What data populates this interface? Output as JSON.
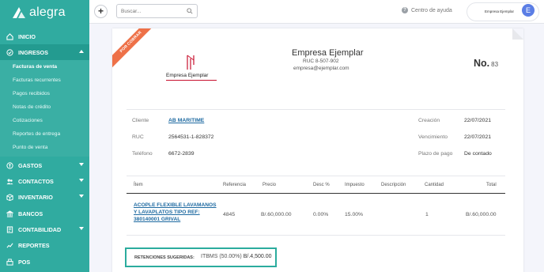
{
  "app": {
    "logo_text": "alegra"
  },
  "topbar": {
    "search_placeholder": "Buscar...",
    "help_label": "Centro de ayuda",
    "company_logo_text": "Empresa Ejemplar",
    "avatar_initial": "E"
  },
  "sidebar": {
    "items": [
      {
        "label": "Inicio"
      },
      {
        "label": "Ingresos"
      },
      {
        "label": "Gastos"
      },
      {
        "label": "Contactos"
      },
      {
        "label": "Inventario"
      },
      {
        "label": "Bancos"
      },
      {
        "label": "Contabilidad"
      },
      {
        "label": "Reportes"
      },
      {
        "label": "POS"
      }
    ],
    "submenu": [
      {
        "label": "Facturas de venta"
      },
      {
        "label": "Facturas recurrentes"
      },
      {
        "label": "Pagos recibidos"
      },
      {
        "label": "Notas de crédito"
      },
      {
        "label": "Cotizaciones"
      },
      {
        "label": "Reportes de entrega"
      },
      {
        "label": "Punto de venta"
      }
    ]
  },
  "invoice": {
    "ribbon": "Por cobrar",
    "brand_name": "Empresa Ejemplar",
    "company_name": "Empresa Ejemplar",
    "company_ruc": "RUC 8-507-902",
    "company_email": "empresa@ejemplar.com",
    "number_label": "No.",
    "number": "83",
    "client_label": "Cliente",
    "client": "AB MARITIME",
    "ruc_label": "RUC",
    "ruc": "2564531-1-828372",
    "phone_label": "Teléfono",
    "phone": "6672-2839",
    "created_label": "Creación",
    "created": "22/07/2021",
    "due_label": "Vencimiento",
    "due": "22/07/2021",
    "term_label": "Plazo de pago",
    "term": "De contado",
    "columns": [
      "Ítem",
      "Referencia",
      "Precio",
      "Desc %",
      "Impuesto",
      "Descripción",
      "Cantidad",
      "Total"
    ],
    "row": {
      "item": "ACOPLE FLEXIBLE LAVAMANOS Y LAVAPLATOS TIPO REF: 380140001 GRIVAL",
      "reference": "4845",
      "price": "B/.60,000.00",
      "discount": "0.00%",
      "tax": "15.00%",
      "description": "",
      "quantity": "1",
      "total": "B/.60,000.00"
    },
    "retentions_label": "RETENCIONES SUGERIDAS:",
    "retentions_detail": "ITBMS (50.00%)",
    "retentions_amount": "B/.4,500.00"
  },
  "colors": {
    "sidebar": "#30aba0",
    "accent": "#2bac9e",
    "ribbon": "#ee7148",
    "link": "#1e6aa1"
  }
}
